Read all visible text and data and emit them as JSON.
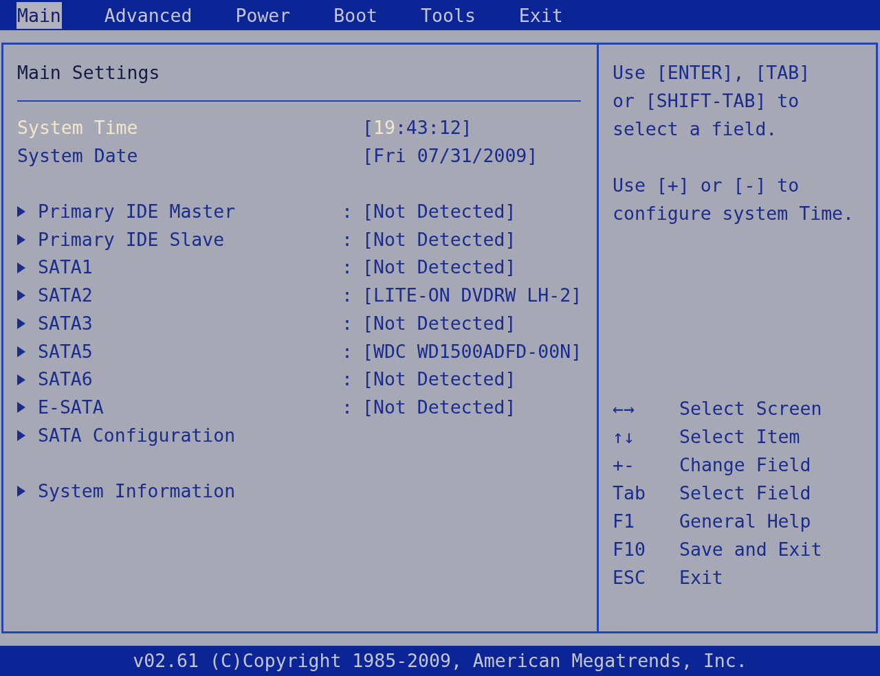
{
  "menu_bar": {
    "tabs": [
      {
        "label": "Main",
        "selected": true
      },
      {
        "label": "Advanced",
        "selected": false
      },
      {
        "label": "Power",
        "selected": false
      },
      {
        "label": "Boot",
        "selected": false
      },
      {
        "label": "Tools",
        "selected": false
      },
      {
        "label": "Exit",
        "selected": false
      }
    ]
  },
  "main_panel": {
    "title": "Main Settings",
    "groups": [
      {
        "items": [
          {
            "kind": "setting",
            "label": "System Time",
            "selected": true,
            "value_segments": [
              {
                "text": "[",
                "selected": false
              },
              {
                "text": "19",
                "selected": true
              },
              {
                "text": ":43:12]",
                "selected": false
              }
            ]
          },
          {
            "kind": "setting",
            "label": "System Date",
            "selected": false,
            "value": "[Fri 07/31/2009]"
          }
        ]
      },
      {
        "items": [
          {
            "kind": "submenu",
            "label": "Primary IDE Master",
            "selected": false,
            "separator": ":",
            "value": "[Not Detected]"
          },
          {
            "kind": "submenu",
            "label": "Primary IDE Slave",
            "selected": false,
            "separator": ":",
            "value": "[Not Detected]"
          },
          {
            "kind": "submenu",
            "label": "SATA1",
            "selected": false,
            "separator": ":",
            "value": "[Not Detected]"
          },
          {
            "kind": "submenu",
            "label": "SATA2",
            "selected": false,
            "separator": ":",
            "value": "[LITE-ON DVDRW LH-2]"
          },
          {
            "kind": "submenu",
            "label": "SATA3",
            "selected": false,
            "separator": ":",
            "value": "[Not Detected]"
          },
          {
            "kind": "submenu",
            "label": "SATA5",
            "selected": false,
            "separator": ":",
            "value": "[WDC WD1500ADFD-00N]"
          },
          {
            "kind": "submenu",
            "label": "SATA6",
            "selected": false,
            "separator": ":",
            "value": "[Not Detected]"
          },
          {
            "kind": "submenu",
            "label": "E-SATA",
            "selected": false,
            "separator": ":",
            "value": "[Not Detected]"
          },
          {
            "kind": "submenu",
            "label": "SATA Configuration",
            "selected": false
          }
        ]
      },
      {
        "items": [
          {
            "kind": "submenu",
            "label": "System Information",
            "selected": false
          }
        ]
      }
    ]
  },
  "help_panel": {
    "paragraphs": [
      "Use [ENTER], [TAB]\nor [SHIFT-TAB] to\nselect a field.",
      "Use [+] or [-] to\nconfigure system Time."
    ],
    "keys": [
      {
        "key": "←→",
        "action": "Select Screen"
      },
      {
        "key": "↑↓",
        "action": "Select Item"
      },
      {
        "key": "+-",
        "action": "Change Field"
      },
      {
        "key": "Tab",
        "action": "Select Field"
      },
      {
        "key": "F1",
        "action": "General Help"
      },
      {
        "key": "F10",
        "action": "Save and Exit"
      },
      {
        "key": "ESC",
        "action": "Exit"
      }
    ]
  },
  "status_bar": {
    "text": "v02.61 (C)Copyright 1985-2009, American Megatrends, Inc."
  }
}
